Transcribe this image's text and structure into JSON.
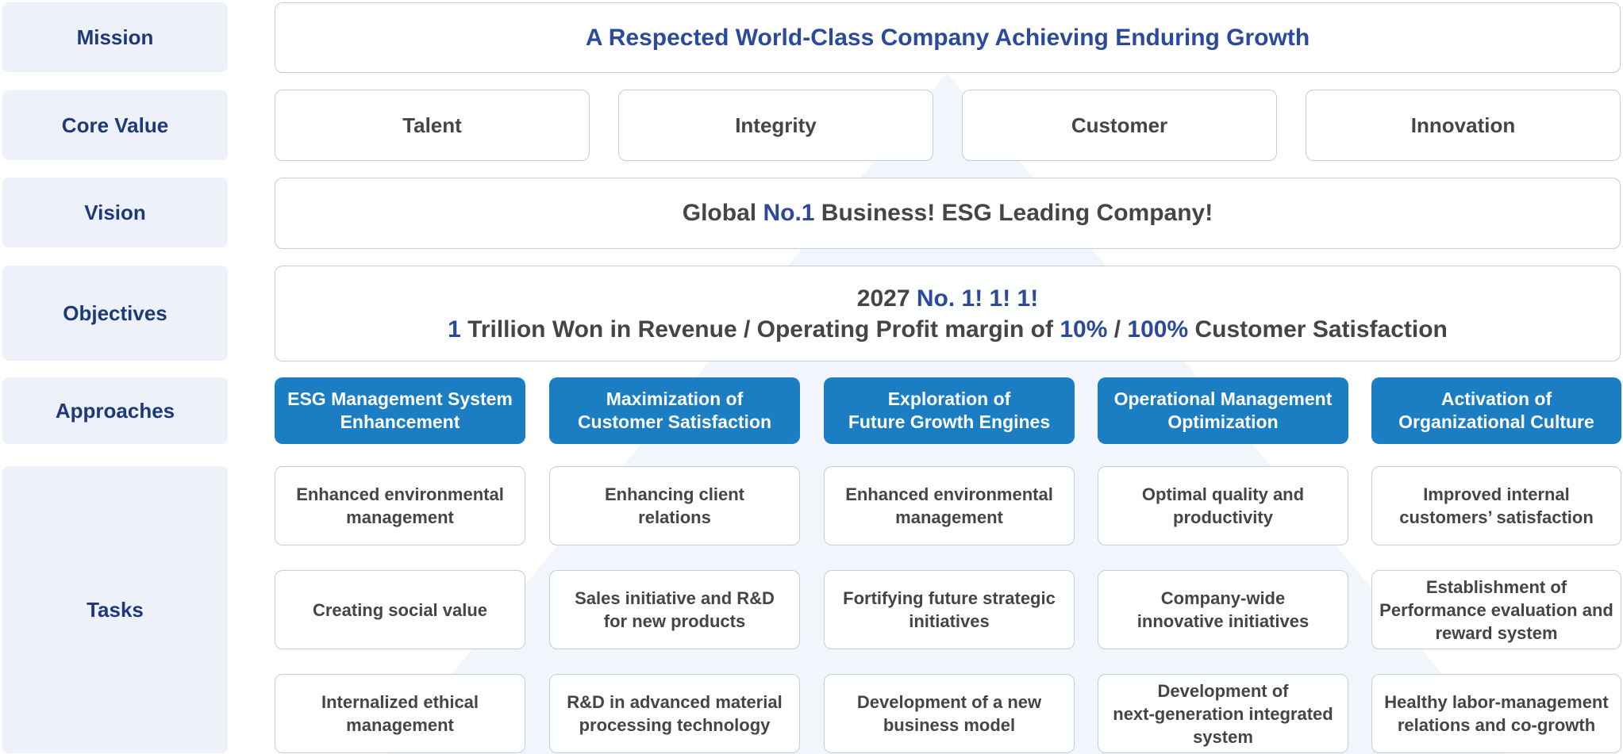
{
  "labels": {
    "mission": "Mission",
    "core_value": "Core Value",
    "vision": "Vision",
    "objectives": "Objectives",
    "approaches": "Approaches",
    "tasks": "Tasks"
  },
  "mission": "A Respected World-Class Company Achieving Enduring Growth",
  "core_values": [
    "Talent",
    "Integrity",
    "Customer",
    "Innovation"
  ],
  "vision": {
    "pre": "Global ",
    "accent": "No.1",
    "post": " Business! ESG Leading Company!"
  },
  "objectives": {
    "line1_year": "2027 ",
    "line1_accent": "No. 1! 1! 1!",
    "line2_a": "1",
    "line2_b": " Trillion Won in Revenue / Operating Profit margin of ",
    "line2_c": "10%",
    "line2_d": " / ",
    "line2_e": "100%",
    "line2_f": " Customer Satisfaction"
  },
  "approaches": [
    "ESG Management System\nEnhancement",
    "Maximization of\nCustomer Satisfaction",
    "Exploration of\nFuture Growth Engines",
    "Operational Management\nOptimization",
    "Activation of\nOrganizational Culture"
  ],
  "tasks": [
    [
      "Enhanced environmental\nmanagement",
      "Creating social value",
      "Internalized ethical\nmanagement"
    ],
    [
      "Enhancing client\nrelations",
      "Sales initiative and R&D\nfor new products",
      "R&D in advanced material\nprocessing technology"
    ],
    [
      "Enhanced environmental\nmanagement",
      "Fortifying future strategic\ninitiatives",
      "Development of a new\nbusiness model"
    ],
    [
      "Optimal quality and\nproductivity",
      "Company-wide\ninnovative initiatives",
      "Development of\nnext-generation integrated\nsystem"
    ],
    [
      "Improved internal\ncustomers’ satisfaction",
      "Establishment of\nPerformance evaluation and\nreward system",
      "Healthy labor-management\nrelations and co-growth"
    ]
  ],
  "colors": {
    "accent_text": "#2b4a9b",
    "label_text": "#1c3a7a",
    "label_bg": "#eef1fa",
    "approach_bg": "#1b7ec2",
    "border": "#c9ccd3",
    "body_text": "#454545"
  }
}
